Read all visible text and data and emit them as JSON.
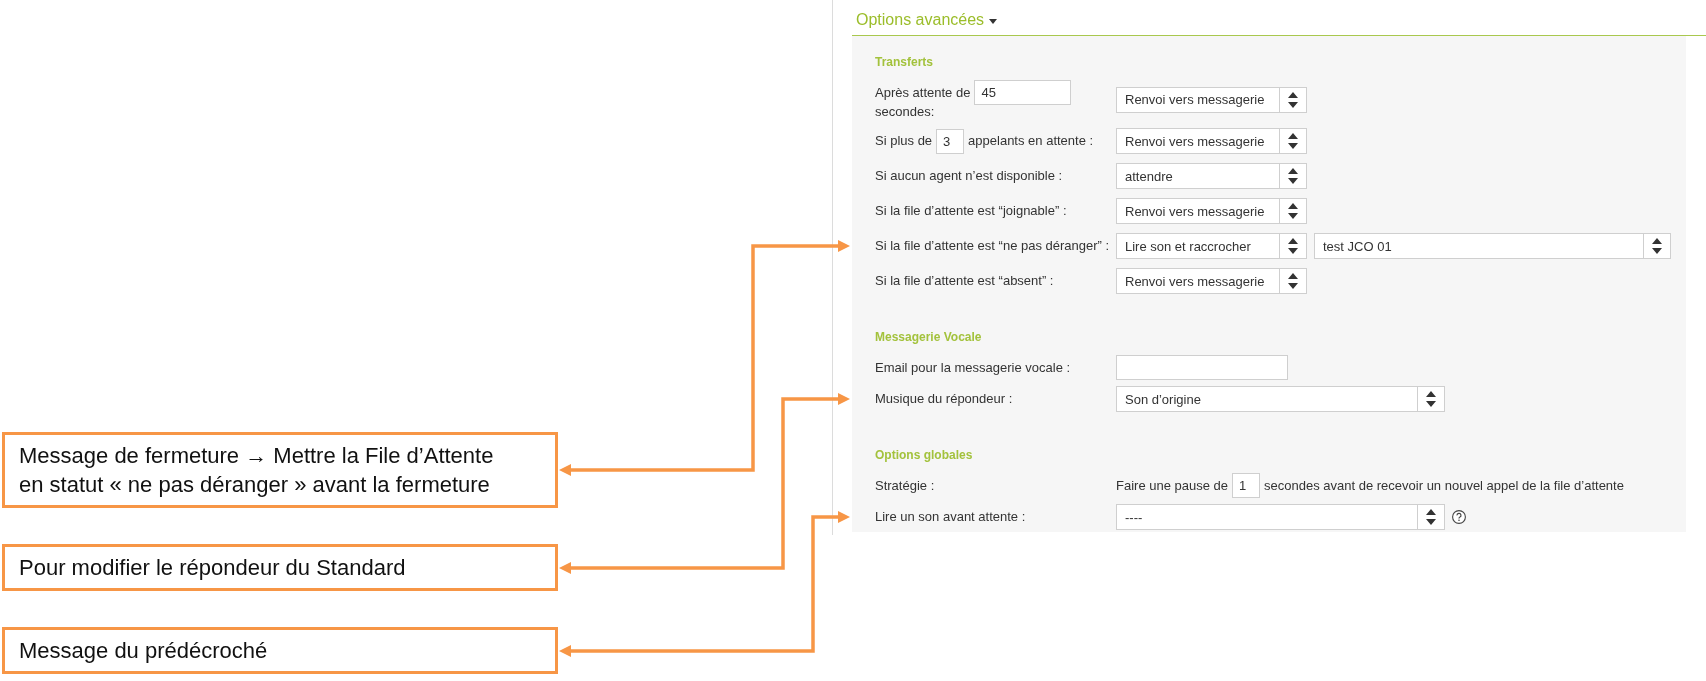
{
  "header": {
    "title": "Options avancées"
  },
  "sections": [
    {
      "title": "Transferts",
      "rows": [
        {
          "kind": "inline",
          "label": "Après attente de",
          "input": "45",
          "label_after": "secondes:",
          "select": "Renvoi vers messagerie"
        },
        {
          "kind": "inline",
          "label": "Si plus de",
          "input": "3",
          "label_after": "appelants en attente :",
          "select": "Renvoi vers messagerie"
        },
        {
          "kind": "select",
          "label": "Si aucun agent n’est disponible :",
          "select": "attendre"
        },
        {
          "kind": "select",
          "label": "Si la file d’attente est “joignable” :",
          "select": "Renvoi vers messagerie"
        },
        {
          "kind": "select",
          "label": "Si la file d’attente est “ne pas déranger” :",
          "select": "Lire son et raccrocher",
          "select_2": "test JCO 01"
        },
        {
          "kind": "select",
          "label": "Si la file d’attente est “absent” :",
          "select": "Renvoi vers messagerie"
        }
      ]
    },
    {
      "title": "Messagerie Vocale",
      "rows": [
        {
          "kind": "text_field",
          "label": "Email pour la messagerie vocale :"
        },
        {
          "kind": "select",
          "label": "Musique du répondeur :",
          "select": "Son d’origine"
        }
      ]
    },
    {
      "title": "Options globales",
      "rows": [
        {
          "kind": "sentence",
          "label": "Stratégie :",
          "text_before": "Faire une pause de",
          "input": "1",
          "text_after": "secondes avant de recevoir un nouvel appel de la file d’attente"
        },
        {
          "kind": "select",
          "label": "Lire un son avant attente :",
          "select": "----",
          "help": true
        }
      ]
    }
  ],
  "callouts": [
    {
      "text": "Message de fermeture → Mettre la File d’Attente en statut « ne pas déranger » avant la fermeture"
    },
    {
      "text": "Pour modifier le répondeur du Standard"
    },
    {
      "text": "Message du prédécroché"
    }
  ]
}
